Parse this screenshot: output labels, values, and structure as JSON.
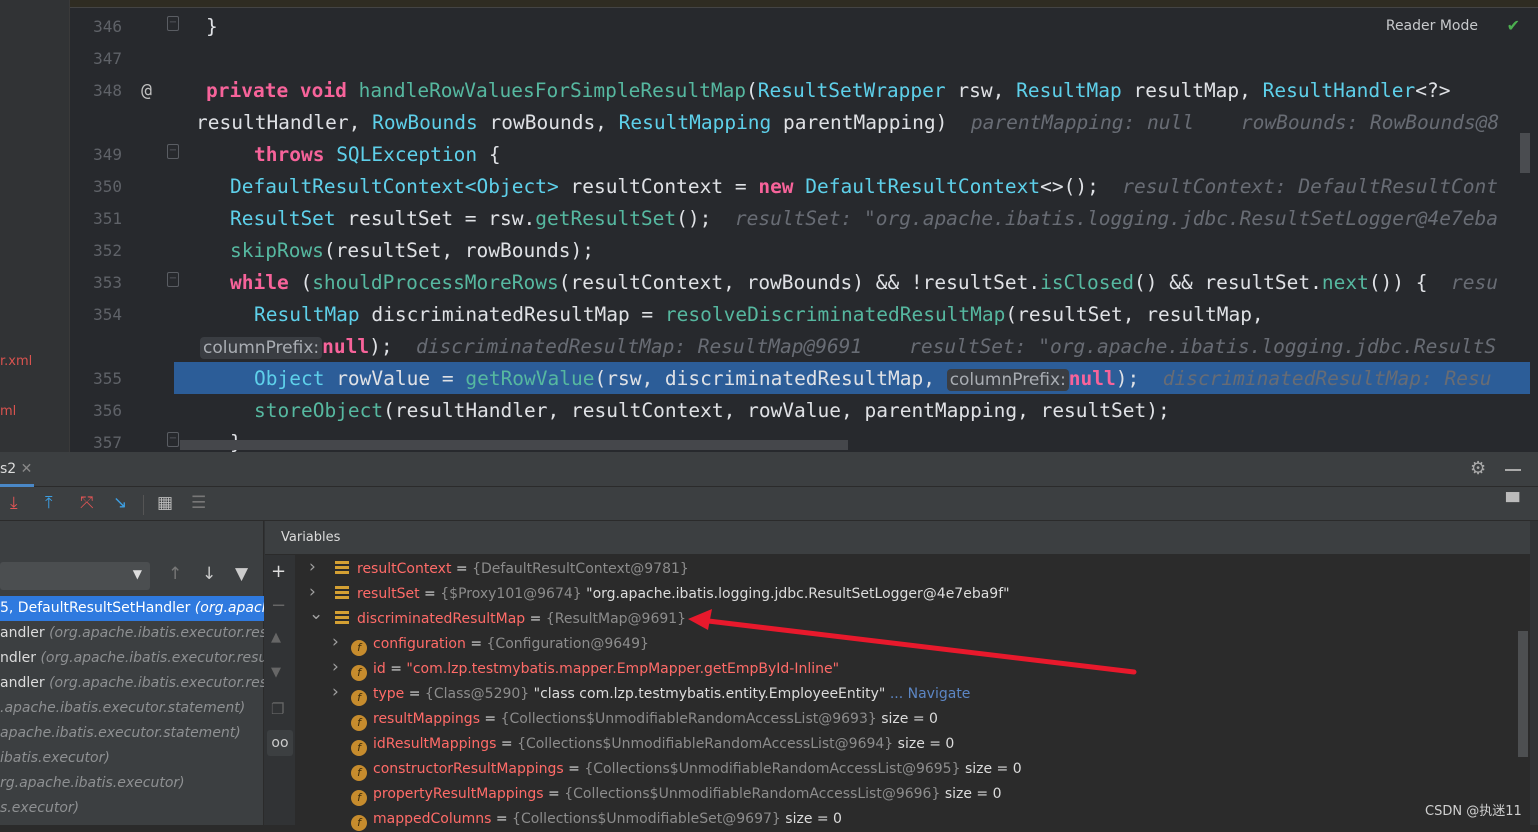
{
  "left_files": [
    "r.xml",
    "ml"
  ],
  "editor": {
    "reader_mode": "Reader Mode",
    "lines": [
      {
        "n": "346",
        "indent": 0,
        "tokens": [
          [
            "p",
            "}"
          ]
        ]
      },
      {
        "n": "347",
        "indent": 0,
        "tokens": []
      },
      {
        "n": "348",
        "indent": 0,
        "marker": "@",
        "tokens": [
          [
            "k",
            "private void "
          ],
          [
            "m",
            "handleRowValuesForSimpleResultMap"
          ],
          [
            "p",
            "("
          ],
          [
            "ty",
            "ResultSetWrapper"
          ],
          [
            "p",
            " rsw, "
          ],
          [
            "ty",
            "ResultMap"
          ],
          [
            "p",
            " resultMap, "
          ],
          [
            "ty",
            "ResultHandler"
          ],
          [
            "p",
            "<?>"
          ]
        ]
      },
      {
        "n": "",
        "indent": -1,
        "tokens": [
          [
            "p",
            "resultHandler, "
          ],
          [
            "ty",
            "RowBounds"
          ],
          [
            "p",
            " rowBounds, "
          ],
          [
            "ty",
            "ResultMapping"
          ],
          [
            "p",
            " parentMapping)  "
          ],
          [
            "h",
            "parentMapping: null    rowBounds: RowBounds@8"
          ]
        ]
      },
      {
        "n": "349",
        "indent": 4,
        "tokens": [
          [
            "k",
            "throws "
          ],
          [
            "ty",
            "SQLException"
          ],
          [
            "p",
            " {"
          ]
        ]
      },
      {
        "n": "350",
        "indent": 2,
        "tokens": [
          [
            "ty",
            "DefaultResultContext<Object>"
          ],
          [
            "p",
            " resultContext = "
          ],
          [
            "k",
            "new "
          ],
          [
            "ty",
            "DefaultResultContext"
          ],
          [
            "p",
            "<>();  "
          ],
          [
            "h",
            "resultContext: DefaultResultCont"
          ]
        ]
      },
      {
        "n": "351",
        "indent": 2,
        "tokens": [
          [
            "ty",
            "ResultSet"
          ],
          [
            "p",
            " resultSet = rsw."
          ],
          [
            "m",
            "getResultSet"
          ],
          [
            "p",
            "();  "
          ],
          [
            "h",
            "resultSet: \"org.apache.ibatis.logging.jdbc.ResultSetLogger@4e7eba"
          ]
        ]
      },
      {
        "n": "352",
        "indent": 2,
        "tokens": [
          [
            "m",
            "skipRows"
          ],
          [
            "p",
            "(resultSet, rowBounds);"
          ]
        ]
      },
      {
        "n": "353",
        "indent": 2,
        "tokens": [
          [
            "k",
            "while"
          ],
          [
            "p",
            " ("
          ],
          [
            "m",
            "shouldProcessMoreRows"
          ],
          [
            "p",
            "(resultContext, rowBounds) && !resultSet."
          ],
          [
            "m",
            "isClosed"
          ],
          [
            "p",
            "() && resultSet."
          ],
          [
            "m",
            "next"
          ],
          [
            "p",
            "()) {  "
          ],
          [
            "h",
            "resu"
          ]
        ]
      },
      {
        "n": "354",
        "indent": 4,
        "tokens": [
          [
            "ty",
            "ResultMap"
          ],
          [
            "p",
            " discriminatedResultMap = "
          ],
          [
            "m",
            "resolveDiscriminatedResultMap"
          ],
          [
            "p",
            "(resultSet, resultMap,"
          ]
        ]
      },
      {
        "n": "",
        "indent": -0.1,
        "tokens": [
          [
            "ih",
            "columnPrefix:"
          ],
          [
            "k",
            "null"
          ],
          [
            "p",
            ");  "
          ],
          [
            "h",
            "discriminatedResultMap: ResultMap@9691    resultSet: \"org.apache.ibatis.logging.jdbc.ResultS"
          ]
        ]
      },
      {
        "n": "355",
        "indent": 4,
        "tokens": [
          [
            "ty",
            "Object"
          ],
          [
            "p",
            " rowValue = "
          ],
          [
            "m",
            "getRowValue"
          ],
          [
            "p",
            "(rsw, discriminatedResultMap, "
          ],
          [
            "ih",
            "columnPrefix:"
          ],
          [
            "k",
            "null"
          ],
          [
            "p",
            ");  "
          ],
          [
            "h",
            "discriminatedResultMap: Resu"
          ]
        ]
      },
      {
        "n": "356",
        "indent": 4,
        "tokens": [
          [
            "m",
            "storeObject"
          ],
          [
            "p",
            "(resultHandler, resultContext, rowValue, parentMapping, resultSet);"
          ]
        ]
      },
      {
        "n": "357",
        "indent": 2,
        "tokens": [
          [
            "p",
            "}"
          ]
        ]
      }
    ]
  },
  "debug": {
    "tab_label": "s2",
    "variables_title": "Variables",
    "frames": [
      {
        "main": "5, DefaultResultSetHandler ",
        "pkg": "(org.apache",
        "selected": true
      },
      {
        "main": "andler ",
        "pkg": "(org.apache.ibatis.executor.resul"
      },
      {
        "main": "ndler ",
        "pkg": "(org.apache.ibatis.executor.results"
      },
      {
        "main": "andler ",
        "pkg": "(org.apache.ibatis.executor.result"
      },
      {
        "main": "",
        "pkg": ".apache.ibatis.executor.statement)"
      },
      {
        "main": "",
        "pkg": "apache.ibatis.executor.statement)"
      },
      {
        "main": "",
        "pkg": "ibatis.executor)"
      },
      {
        "main": "",
        "pkg": "rg.apache.ibatis.executor)"
      },
      {
        "main": "",
        "pkg": "s.executor)"
      }
    ],
    "variables": [
      {
        "level": 0,
        "expand": "right",
        "icon": "list",
        "name": "resultContext",
        "ref": "{DefaultResultContext@9781}"
      },
      {
        "level": 0,
        "expand": "right",
        "icon": "list",
        "name": "resultSet",
        "ref": "{$Proxy101@9674}",
        "value": "\"org.apache.ibatis.logging.jdbc.ResultSetLogger@4e7eba9f\""
      },
      {
        "level": 0,
        "expand": "down",
        "icon": "list",
        "name": "discriminatedResultMap",
        "ref": "{ResultMap@9691}"
      },
      {
        "level": 1,
        "expand": "right",
        "icon": "field",
        "name": "configuration",
        "ref": "{Configuration@9649}"
      },
      {
        "level": 1,
        "expand": "right",
        "icon": "field",
        "name": "id",
        "str": "\"com.lzp.testmybatis.mapper.EmpMapper.getEmpById-Inline\""
      },
      {
        "level": 1,
        "expand": "right",
        "icon": "field",
        "name": "type",
        "ref": "{Class@5290}",
        "value": "\"class com.lzp.testmybatis.entity.EmployeeEntity\"",
        "link": "... Navigate"
      },
      {
        "level": 1,
        "icon": "field",
        "name": "resultMappings",
        "ref": "{Collections$UnmodifiableRandomAccessList@9693}",
        "value": " size = 0"
      },
      {
        "level": 1,
        "icon": "field",
        "name": "idResultMappings",
        "ref": "{Collections$UnmodifiableRandomAccessList@9694}",
        "value": " size = 0"
      },
      {
        "level": 1,
        "icon": "field",
        "name": "constructorResultMappings",
        "ref": "{Collections$UnmodifiableRandomAccessList@9695}",
        "value": " size = 0"
      },
      {
        "level": 1,
        "icon": "field",
        "name": "propertyResultMappings",
        "ref": "{Collections$UnmodifiableRandomAccessList@9696}",
        "value": " size = 0"
      },
      {
        "level": 1,
        "icon": "field",
        "name": "mappedColumns",
        "ref": "{Collections$UnmodifiableSet@9697}",
        "value": " size = 0"
      }
    ]
  },
  "annotation_color": "#e8192c",
  "highlight_color": "#2c5d98",
  "watermark": "CSDN @执迷11"
}
